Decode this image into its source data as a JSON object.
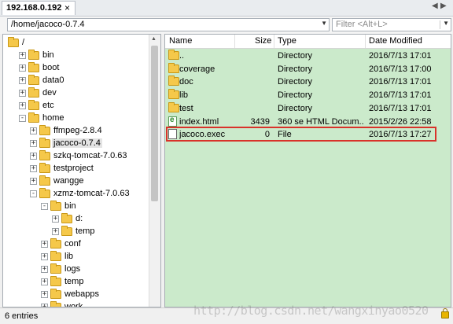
{
  "tab": {
    "title": "192.168.0.192",
    "close_glyph": "×"
  },
  "nav": {
    "prev_icon": "triangle-left-icon",
    "next_icon": "triangle-right-icon",
    "menu_icon": "triangle-down-icon"
  },
  "path": {
    "value": "/home/jacoco-0.7.4"
  },
  "filter": {
    "placeholder": "Filter <Alt+L>"
  },
  "tree": [
    {
      "label": "/",
      "depth": 0,
      "exp": "",
      "selected": false
    },
    {
      "label": "bin",
      "depth": 1,
      "exp": "+",
      "selected": false
    },
    {
      "label": "boot",
      "depth": 1,
      "exp": "+",
      "selected": false
    },
    {
      "label": "data0",
      "depth": 1,
      "exp": "+",
      "selected": false
    },
    {
      "label": "dev",
      "depth": 1,
      "exp": "+",
      "selected": false
    },
    {
      "label": "etc",
      "depth": 1,
      "exp": "+",
      "selected": false
    },
    {
      "label": "home",
      "depth": 1,
      "exp": "-",
      "selected": false
    },
    {
      "label": "ffmpeg-2.8.4",
      "depth": 2,
      "exp": "+",
      "selected": false
    },
    {
      "label": "jacoco-0.7.4",
      "depth": 2,
      "exp": "+",
      "selected": true
    },
    {
      "label": "szkq-tomcat-7.0.63",
      "depth": 2,
      "exp": "+",
      "selected": false
    },
    {
      "label": "testproject",
      "depth": 2,
      "exp": "+",
      "selected": false
    },
    {
      "label": "wangge",
      "depth": 2,
      "exp": "+",
      "selected": false
    },
    {
      "label": "xzmz-tomcat-7.0.63",
      "depth": 2,
      "exp": "-",
      "selected": false
    },
    {
      "label": "bin",
      "depth": 3,
      "exp": "-",
      "selected": false
    },
    {
      "label": "d:",
      "depth": 4,
      "exp": "+",
      "selected": false
    },
    {
      "label": "temp",
      "depth": 4,
      "exp": "+",
      "selected": false
    },
    {
      "label": "conf",
      "depth": 3,
      "exp": "+",
      "selected": false
    },
    {
      "label": "lib",
      "depth": 3,
      "exp": "+",
      "selected": false
    },
    {
      "label": "logs",
      "depth": 3,
      "exp": "+",
      "selected": false
    },
    {
      "label": "temp",
      "depth": 3,
      "exp": "+",
      "selected": false
    },
    {
      "label": "webapps",
      "depth": 3,
      "exp": "+",
      "selected": false
    },
    {
      "label": "work",
      "depth": 3,
      "exp": "+",
      "selected": false
    }
  ],
  "columns": {
    "name": "Name",
    "size": "Size",
    "type": "Type",
    "modified": "Date Modified"
  },
  "files": [
    {
      "icon": "folder-icon",
      "name": "..",
      "size": "",
      "type": "Directory",
      "modified": "2016/7/13 17:01"
    },
    {
      "icon": "folder-icon",
      "name": "coverage",
      "size": "",
      "type": "Directory",
      "modified": "2016/7/13 17:00"
    },
    {
      "icon": "folder-icon",
      "name": "doc",
      "size": "",
      "type": "Directory",
      "modified": "2016/7/13 17:01"
    },
    {
      "icon": "folder-icon",
      "name": "lib",
      "size": "",
      "type": "Directory",
      "modified": "2016/7/13 17:01"
    },
    {
      "icon": "folder-icon",
      "name": "test",
      "size": "",
      "type": "Directory",
      "modified": "2016/7/13 17:01"
    },
    {
      "icon": "html-file-icon",
      "name": "index.html",
      "size": "3439",
      "type": "360 se HTML Docum...",
      "modified": "2015/2/26 22:58"
    },
    {
      "icon": "file-icon",
      "name": "jacoco.exec",
      "size": "0",
      "type": "File",
      "modified": "2016/7/13 17:27"
    }
  ],
  "status": {
    "text": "6 entries"
  },
  "watermark": "http://blog.csdn.net/wangxinyao0520",
  "colors": {
    "list_bg": "#cbeacb",
    "highlight": "#d9322a",
    "folder": "#f5c84a"
  }
}
